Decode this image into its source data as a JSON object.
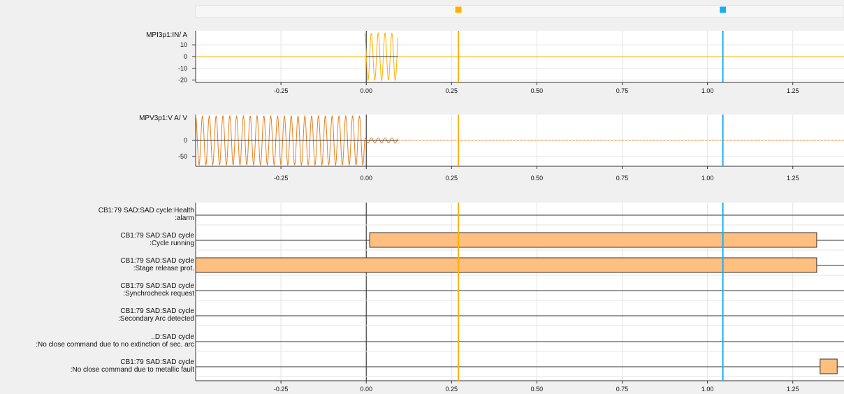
{
  "cursors": [
    {
      "name": "cursor-1",
      "x": 0.27,
      "color": "#ffb000"
    },
    {
      "name": "cursor-2",
      "x": 1.045,
      "color": "#19aef0"
    }
  ],
  "x_axis": {
    "xlim": [
      -0.5,
      1.4
    ],
    "ticks": [
      -0.25,
      0,
      0.25,
      0.5,
      0.75,
      1.0,
      1.25
    ],
    "tick_labels": [
      "-0.25",
      "0.00",
      "0.25",
      "0.50",
      "0.75",
      "1.00",
      "1.25"
    ]
  },
  "colors": {
    "panel_bg": "#f0f0f0",
    "plot_bg": "#ffffff",
    "grid": "#e4e4e4",
    "current_trace": "#ffb000",
    "voltage_trace": "#e8801e",
    "bar_fill": "#ffbf80",
    "bar_stroke": "#333333"
  },
  "chart_data": [
    {
      "type": "line",
      "title": "MPI3p1:IN/ A",
      "ylim": [
        -22,
        22
      ],
      "y_ticks": [
        10,
        0,
        -10,
        -20
      ],
      "y_tick_labels": [
        "10",
        "0",
        "-10",
        "-20"
      ],
      "series": [
        {
          "name": "MPI3p1:IN",
          "color": "#ffb000",
          "values": [
            {
              "x_range": [
                -0.5,
                0.0
              ],
              "amplitude": 0
            },
            {
              "x_range": [
                -0.005,
                0.093
              ],
              "amplitude": 20,
              "frequency_hz": 50,
              "note": "decaying-offset"
            },
            {
              "x_range": [
                0.093,
                1.4
              ],
              "amplitude": 0
            }
          ]
        }
      ]
    },
    {
      "type": "line",
      "title": "MPV3p1:V A/ V",
      "ylim": [
        -80,
        80
      ],
      "y_ticks": [
        0,
        -50
      ],
      "y_tick_labels": [
        "0",
        "-50"
      ],
      "series": [
        {
          "name": "MPV3p1:V A",
          "color": "#e8801e",
          "values": [
            {
              "x_range": [
                -0.5,
                -0.005
              ],
              "amplitude": 76,
              "frequency_hz": 50
            },
            {
              "x_range": [
                -0.005,
                0.093
              ],
              "amplitude": 8,
              "frequency_hz": 50
            },
            {
              "x_range": [
                0.093,
                1.4
              ],
              "amplitude": 0,
              "style": "dash"
            }
          ]
        }
      ]
    },
    {
      "type": "digital",
      "signals": [
        {
          "label": [
            "CB1:79 SAD:SAD cycle:Health",
            ":alarm"
          ],
          "on": []
        },
        {
          "label": [
            "CB1:79 SAD:SAD cycle",
            ":Cycle running"
          ],
          "on": [
            [
              0.01,
              1.32
            ]
          ]
        },
        {
          "label": [
            "CB1:79 SAD:SAD cycle",
            ":Stage release prot."
          ],
          "on": [
            [
              -0.5,
              1.32
            ]
          ]
        },
        {
          "label": [
            "CB1:79 SAD:SAD cycle",
            ":Synchrocheck request"
          ],
          "on": []
        },
        {
          "label": [
            "CB1:79 SAD:SAD cycle",
            ":Secondary Arc detected"
          ],
          "on": []
        },
        {
          "label": [
            "..D:SAD cycle",
            ":No close command due to no extinction of sec. arc"
          ],
          "on": []
        },
        {
          "label": [
            "CB1:79 SAD:SAD cycle",
            ":No close command due to metallic fault"
          ],
          "on": [
            [
              1.33,
              1.38
            ]
          ]
        }
      ]
    }
  ]
}
